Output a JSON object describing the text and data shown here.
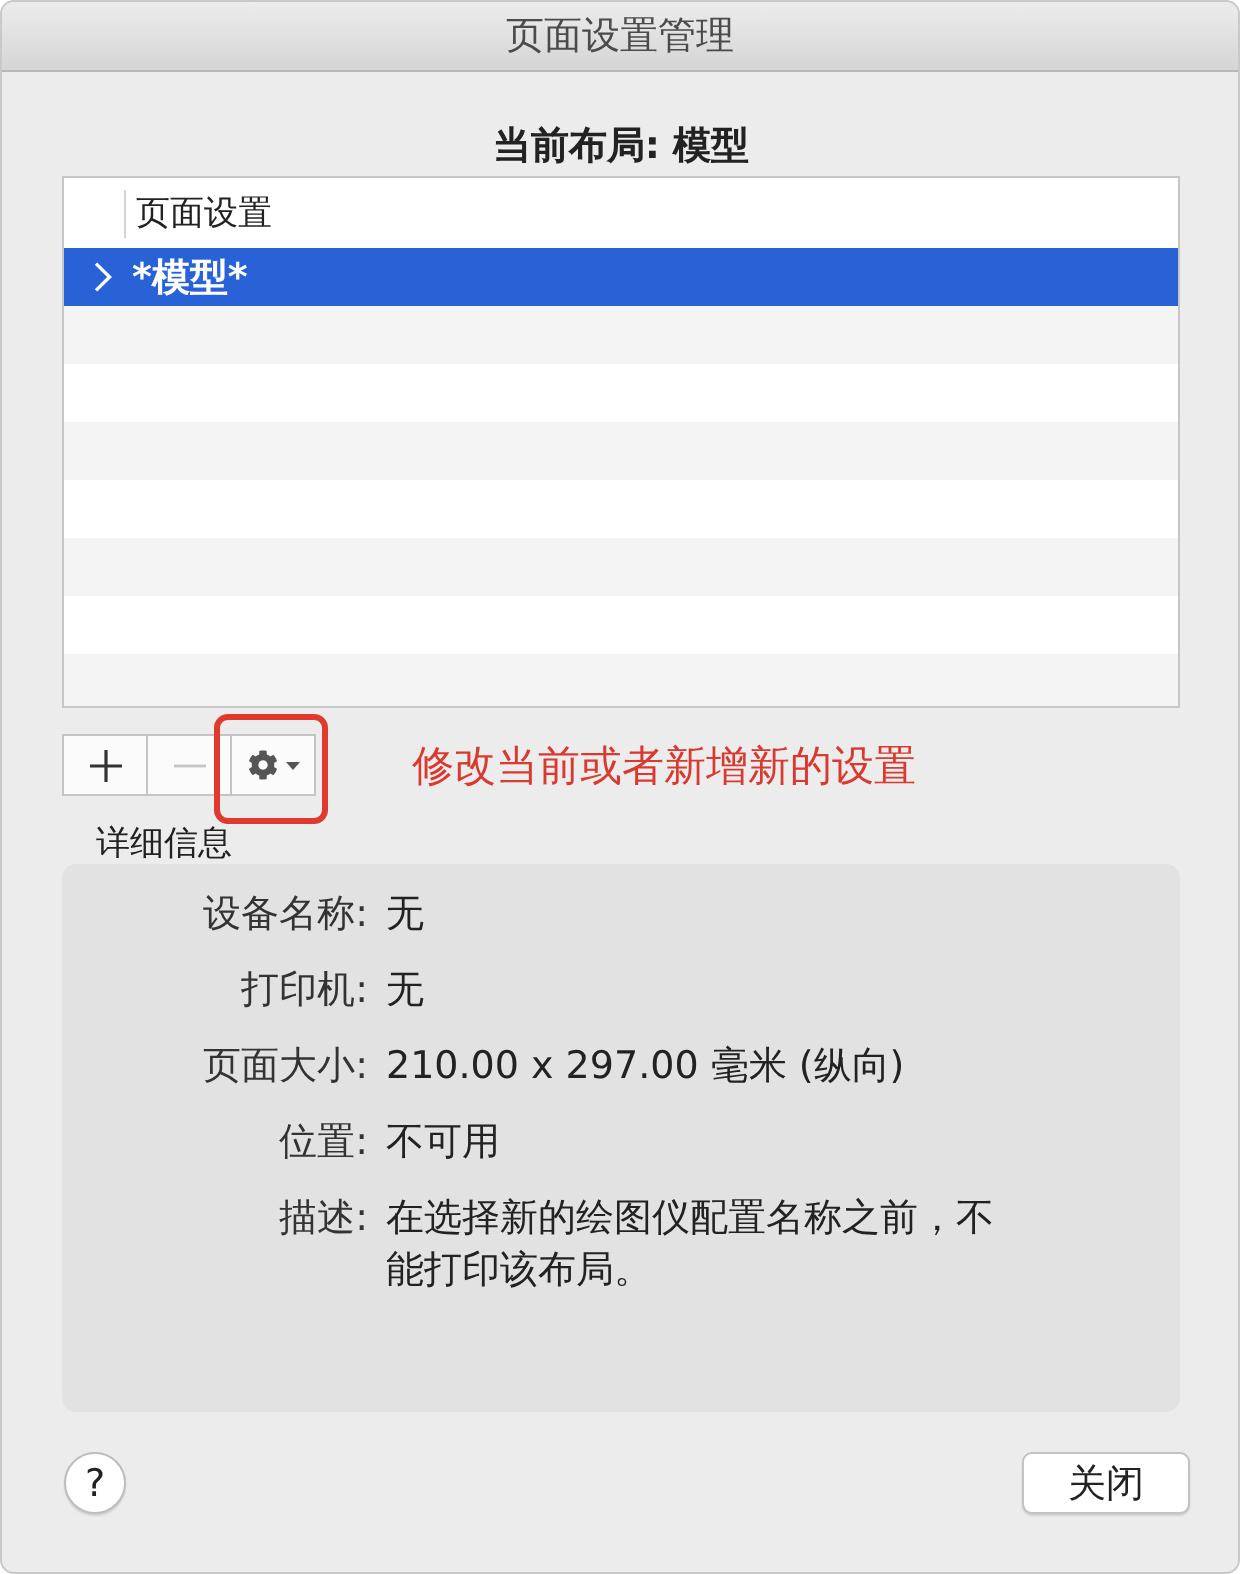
{
  "window": {
    "title": "页面设置管理"
  },
  "current_layout": "当前布局: 模型",
  "table": {
    "columns": [
      "页面设置"
    ],
    "rows": [
      {
        "name": "*模型*",
        "selected": true,
        "expanded": false
      }
    ]
  },
  "toolbar": {
    "buttons": [
      {
        "kind": "add",
        "disabled": false,
        "highlighted": false
      },
      {
        "kind": "remove",
        "disabled": true,
        "highlighted": false
      },
      {
        "kind": "settings-menu",
        "disabled": false,
        "highlighted": true
      }
    ]
  },
  "annotation": {
    "text": "修改当前或者新增新的设置"
  },
  "details": {
    "title": "详细信息",
    "fields": [
      {
        "label": "设备名称:",
        "value": "无"
      },
      {
        "label": "打印机:",
        "value": "无"
      },
      {
        "label": "页面大小:",
        "value": "210.00 x 297.00 毫米 (纵向)"
      },
      {
        "label": "位置:",
        "value": "不可用"
      },
      {
        "label": "描述:",
        "value": "在选择新的绘图仪配置名称之前，不能打印该布局。"
      }
    ]
  },
  "footer": {
    "help_button": "?",
    "close_button": "关闭"
  }
}
